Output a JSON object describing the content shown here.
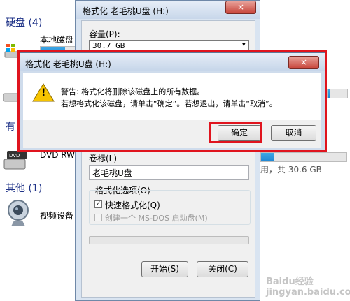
{
  "explorer": {
    "hdd_section": "硬盘 (4)",
    "local_disk_label": "本地磁盘",
    "devices_section_partial": "有",
    "dvd_label": "DVD RW",
    "dvd_usage_text": "用，共 30.6 GB",
    "other_section": "其他 (1)",
    "video_device_label": "视频设备"
  },
  "format_dialog": {
    "title": "格式化 老毛桃U盘 (H:)",
    "capacity_label": "容量(P):",
    "capacity_value": "30.7 GB",
    "volume_label": "卷标(L)",
    "volume_value": "老毛桃U盘",
    "options_label": "格式化选项(O)",
    "quick_format_label": "快速格式化(Q)",
    "quick_format_checked": true,
    "msdos_label": "创建一个 MS-DOS 启动盘(M)",
    "msdos_checked": false,
    "start_button": "开始(S)",
    "close_button": "关闭(C)"
  },
  "warning_dialog": {
    "title": "格式化 老毛桃U盘 (H:)",
    "line1": "警告: 格式化将删除该磁盘上的所有数据。",
    "line2": "若想格式化该磁盘，请单击“确定”。若想退出，请单击“取消”。",
    "ok_button": "确定",
    "cancel_button": "取消"
  },
  "icons": {
    "close": "×",
    "warning": "!",
    "checkmark": "✓",
    "dropdown": "▼"
  },
  "watermark": "Baidu经验 jingyan.baidu.com",
  "colors": {
    "highlight_red": "#e0141e",
    "usage_blue": "#1f86d3",
    "section_blue": "#1e3287"
  },
  "usage": {
    "hdd_1_fraction": 0.7,
    "hdd_2_fraction": 0.1,
    "dvd_fraction": 0.15
  }
}
